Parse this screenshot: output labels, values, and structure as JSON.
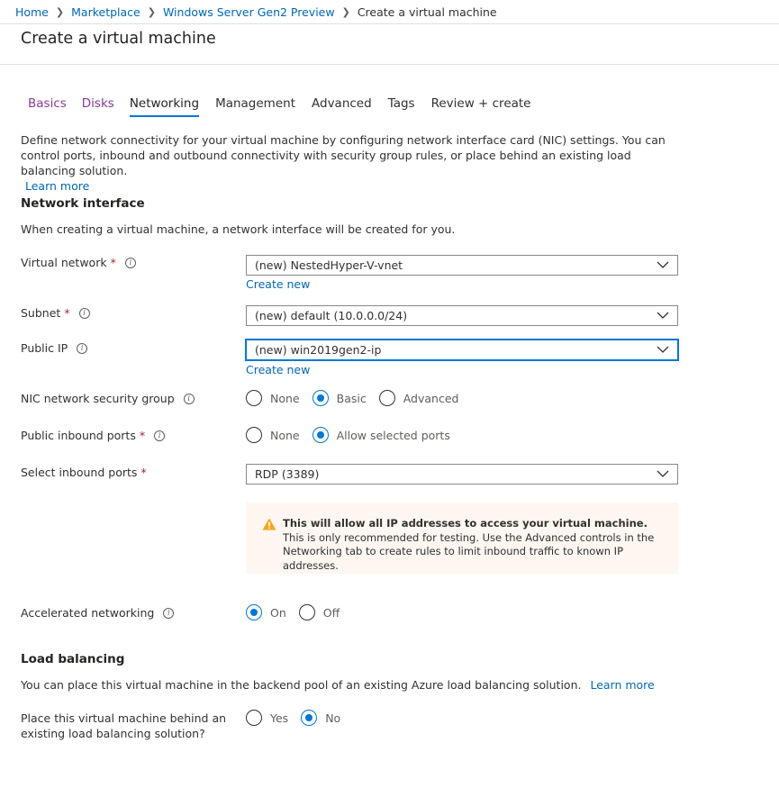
{
  "breadcrumb": {
    "items": [
      "Home",
      "Marketplace",
      "Windows Server Gen2 Preview"
    ],
    "current": "Create a virtual machine"
  },
  "page": {
    "title": "Create a virtual machine"
  },
  "tabs": [
    {
      "label": "Basics"
    },
    {
      "label": "Disks"
    },
    {
      "label": "Networking"
    },
    {
      "label": "Management"
    },
    {
      "label": "Advanced"
    },
    {
      "label": "Tags"
    },
    {
      "label": "Review + create"
    }
  ],
  "intro": {
    "text": "Define network connectivity for your virtual machine by configuring network interface card (NIC) settings. You can control ports, inbound and outbound connectivity with security group rules, or place behind an existing load balancing solution.",
    "learn_more": "Learn more"
  },
  "network_interface": {
    "title": "Network interface",
    "desc": "When creating a virtual machine, a network interface will be created for you."
  },
  "fields": {
    "virtual_network": {
      "label": "Virtual network",
      "value": "(new) NestedHyper-V-vnet",
      "create_new": "Create new"
    },
    "subnet": {
      "label": "Subnet",
      "value": "(new) default (10.0.0.0/24)"
    },
    "public_ip": {
      "label": "Public IP",
      "value": "(new) win2019gen2-ip",
      "create_new": "Create new"
    },
    "nic_nsg": {
      "label": "NIC network security group",
      "options": [
        "None",
        "Basic",
        "Advanced"
      ],
      "selected": "Basic"
    },
    "public_inbound_ports": {
      "label": "Public inbound ports",
      "options": [
        "None",
        "Allow selected ports"
      ],
      "selected": "Allow selected ports"
    },
    "select_inbound_ports": {
      "label": "Select inbound ports",
      "value": "RDP (3389)"
    },
    "accelerated_networking": {
      "label": "Accelerated networking",
      "options": [
        "On",
        "Off"
      ],
      "selected": "On"
    }
  },
  "warning": {
    "bold": "This will allow all IP addresses to access your virtual machine.",
    "text": "This is only recommended for testing.  Use the Advanced controls in the Networking tab to create rules to limit inbound traffic to known IP addresses."
  },
  "load_balancing": {
    "title": "Load balancing",
    "desc": "You can place this virtual machine in the backend pool of an existing Azure load balancing solution.",
    "learn_more": "Learn more",
    "question": "Place this virtual machine behind an existing load balancing solution?",
    "options": [
      "Yes",
      "No"
    ],
    "selected": "No"
  },
  "colors": {
    "accent": "#0078d4",
    "link": "#0067b8",
    "visited_tab": "#8a3a9a",
    "required": "#a4262c",
    "warning_bg": "#fdf6f1",
    "warning_icon": "#f7a21b"
  }
}
